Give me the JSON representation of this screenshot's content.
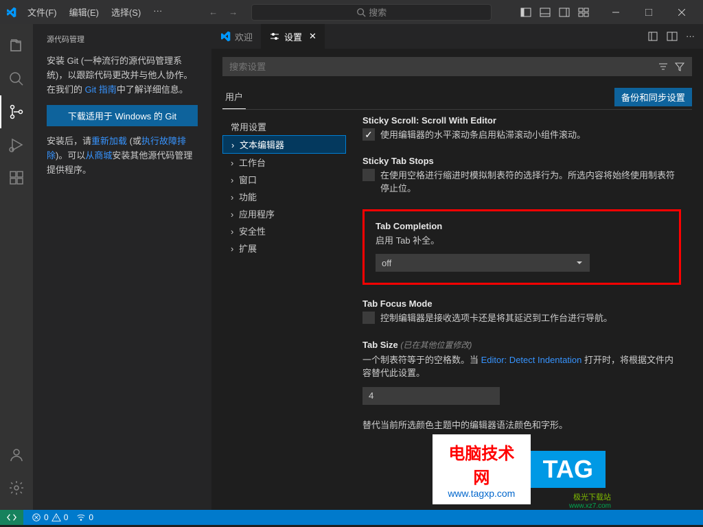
{
  "menu": {
    "file": "文件(F)",
    "edit": "编辑(E)",
    "select": "选择(S)",
    "more": "···"
  },
  "titlebar": {
    "search_placeholder": "搜索"
  },
  "sidebar": {
    "title": "源代码管理",
    "intro_1": "安装 Git (一种流行的源代码管理系统)，以跟踪代码更改并与他人协作。在我们的 ",
    "git_guide": "Git 指南",
    "intro_2": "中了解详细信息。",
    "button": "下载适用于 Windows 的 Git",
    "post_1": "安装后，请",
    "reload": "重新加载",
    "post_2": " (或",
    "trouble": "执行故障排除",
    "post_3": ")。可以",
    "market": "从商城",
    "post_4": "安装其他源代码管理提供程序。"
  },
  "tabs": {
    "welcome": "欢迎",
    "settings": "设置"
  },
  "settings": {
    "search_placeholder": "搜索设置",
    "scope_user": "用户",
    "sync": "备份和同步设置",
    "toc": {
      "common": "常用设置",
      "text_editor": "文本编辑器",
      "workbench": "工作台",
      "window": "窗口",
      "features": "功能",
      "app": "应用程序",
      "security": "安全性",
      "extensions": "扩展"
    },
    "items": {
      "sticky_scroll": {
        "prefix": "Sticky Scroll: ",
        "title": "Scroll With Editor",
        "desc": "使用编辑器的水平滚动条启用粘滞滚动小组件滚动。"
      },
      "sticky_tab": {
        "title": "Sticky Tab Stops",
        "desc": "在使用空格进行缩进时模拟制表符的选择行为。所选内容将始终使用制表符停止位。"
      },
      "tab_completion": {
        "title": "Tab Completion",
        "desc": "启用 Tab 补全。",
        "value": "off"
      },
      "tab_focus": {
        "title": "Tab Focus Mode",
        "desc": "控制编辑器是接收选项卡还是将其延迟到工作台进行导航。"
      },
      "tab_size": {
        "title": "Tab Size",
        "hint": "(已在其他位置修改)",
        "desc_1": "一个制表符等于的空格数。当 ",
        "link": "Editor: Detect Indentation",
        "desc_2": " 打开时，将根据文件内容替代此设置。",
        "value": "4"
      },
      "token_color": {
        "desc": "替代当前所选颜色主题中的编辑器语法颜色和字形。"
      }
    }
  },
  "watermark": {
    "cn": "电脑技术网",
    "url": "www.tagxp.com",
    "tag": "TAG",
    "logo1": "极光下载站",
    "logo2": "www.xz7.com"
  },
  "statusbar": {
    "errors": "0",
    "warnings": "0",
    "port": "0"
  }
}
